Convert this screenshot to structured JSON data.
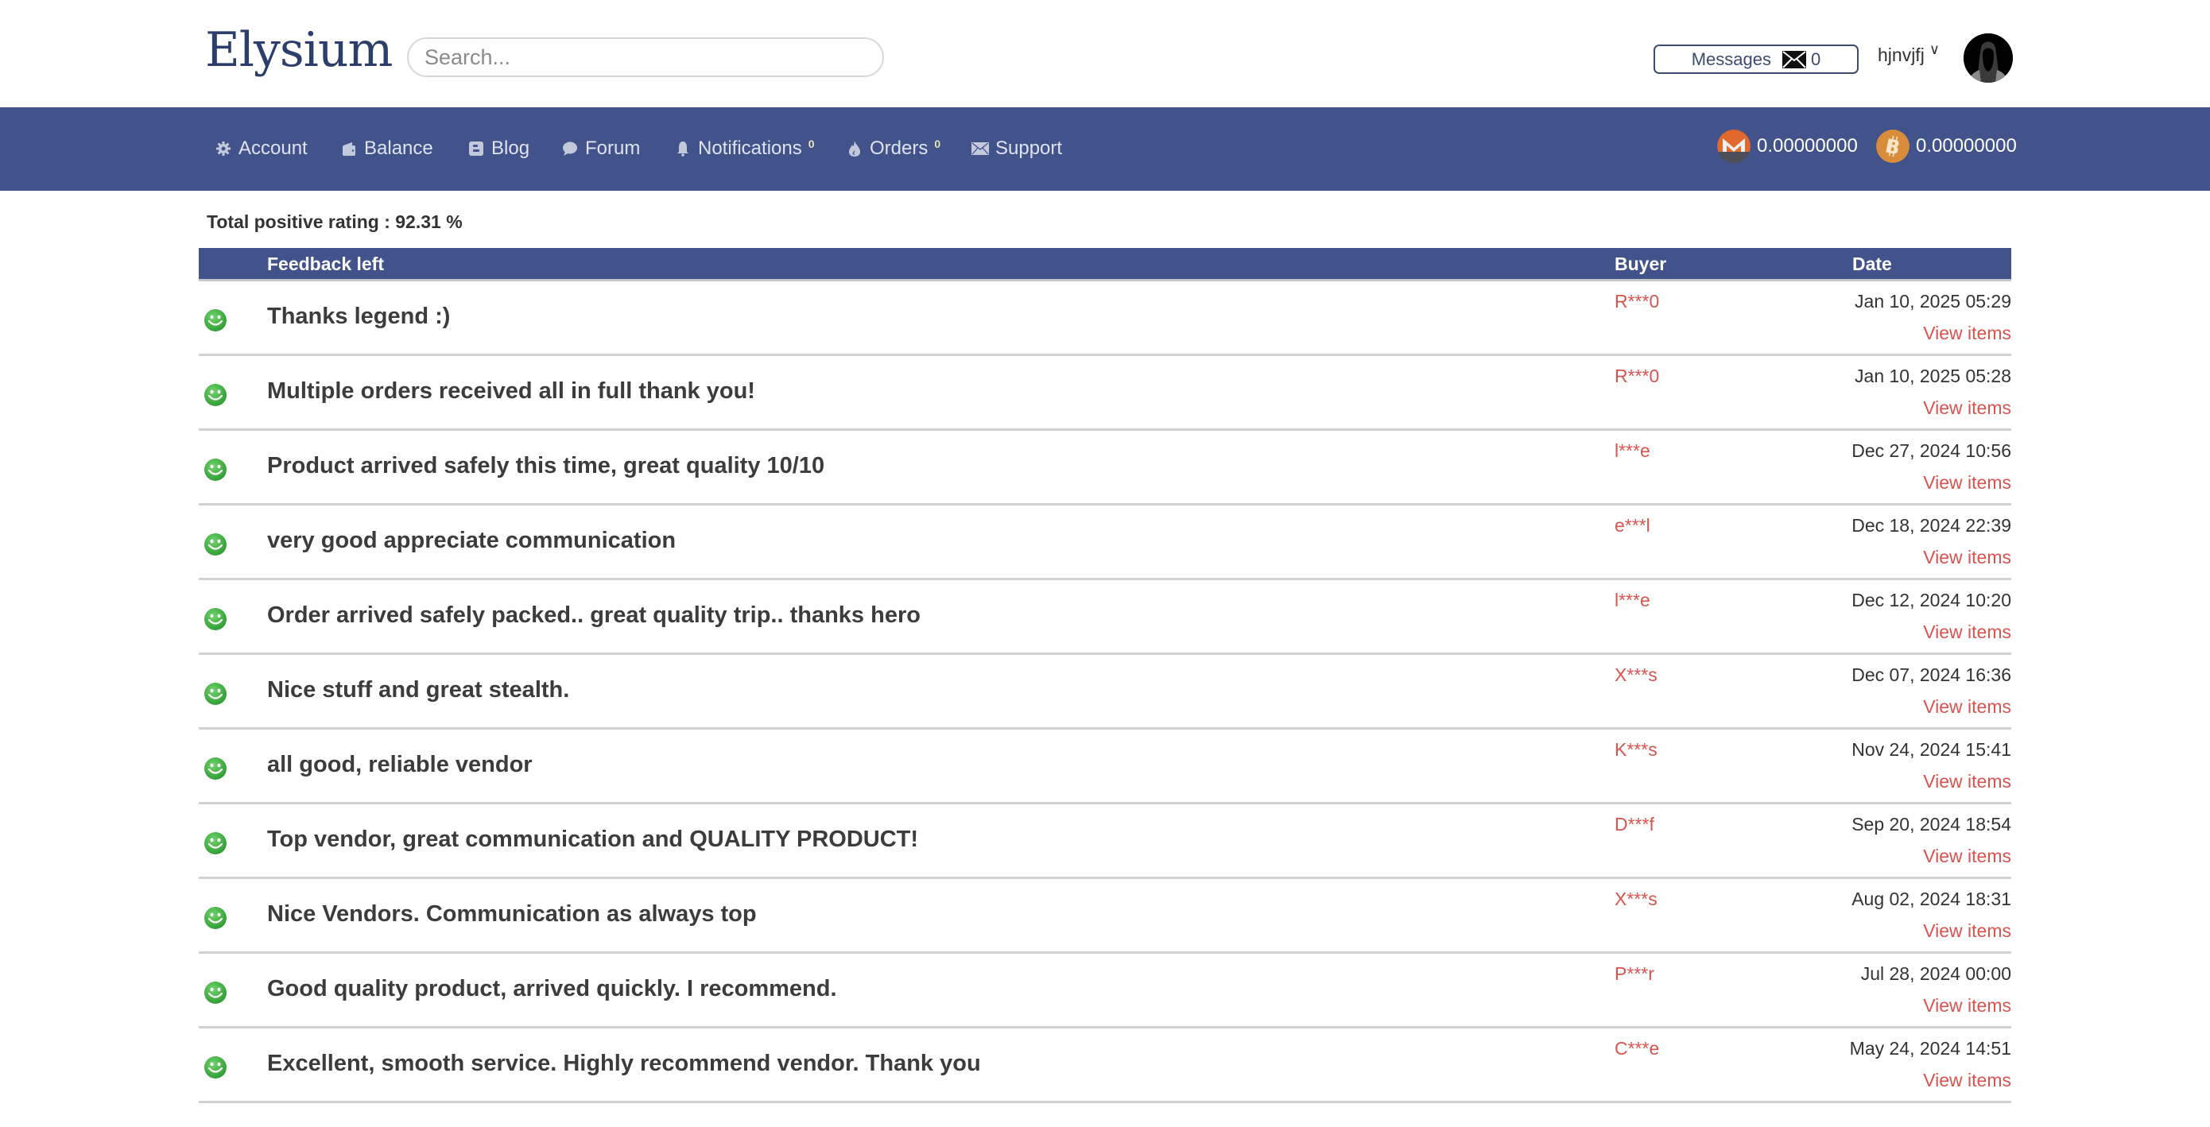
{
  "header": {
    "logo": "Elysium",
    "search_placeholder": "Search...",
    "messages_label": "Messages",
    "messages_count": "0",
    "username": "hjnvjfj",
    "dropdown_glyph": "∨"
  },
  "nav": {
    "items": [
      {
        "label": "Account",
        "icon": "gear-icon",
        "badge": ""
      },
      {
        "label": "Balance",
        "icon": "wallet-icon",
        "badge": ""
      },
      {
        "label": "Blog",
        "icon": "blog-icon",
        "badge": ""
      },
      {
        "label": "Forum",
        "icon": "chat-bubble-icon",
        "badge": ""
      },
      {
        "label": "Notifications",
        "icon": "bell-icon",
        "badge": "0"
      },
      {
        "label": "Orders",
        "icon": "fire-icon",
        "badge": "0"
      },
      {
        "label": "Support",
        "icon": "envelope-icon",
        "badge": ""
      }
    ],
    "balances": [
      {
        "currency": "monero",
        "icon": "monero-icon",
        "amount": "0.00000000",
        "color": "#e0692b"
      },
      {
        "currency": "bitcoin",
        "icon": "bitcoin-icon",
        "amount": "0.00000000",
        "color": "#d98d3a"
      }
    ]
  },
  "rating": {
    "text": "Total positive rating : 92.31 %"
  },
  "table": {
    "columns": [
      "Feedback left",
      "Buyer",
      "Date"
    ],
    "view_label": "View items",
    "rows": [
      {
        "rating": "positive",
        "feedback": "Thanks legend :)",
        "buyer": "R***0",
        "date": "Jan 10, 2025 05:29"
      },
      {
        "rating": "positive",
        "feedback": "Multiple orders received all in full thank you!",
        "buyer": "R***0",
        "date": "Jan 10, 2025 05:28"
      },
      {
        "rating": "positive",
        "feedback": "Product arrived safely this time, great quality 10/10",
        "buyer": "l***e",
        "date": "Dec 27, 2024 10:56"
      },
      {
        "rating": "positive",
        "feedback": "very good appreciate communication",
        "buyer": "e***l",
        "date": "Dec 18, 2024 22:39"
      },
      {
        "rating": "positive",
        "feedback": "Order arrived safely packed.. great quality trip.. thanks hero",
        "buyer": "l***e",
        "date": "Dec 12, 2024 10:20"
      },
      {
        "rating": "positive",
        "feedback": "Nice stuff and great stealth.",
        "buyer": "X***s",
        "date": "Dec 07, 2024 16:36"
      },
      {
        "rating": "positive",
        "feedback": "all good, reliable vendor",
        "buyer": "K***s",
        "date": "Nov 24, 2024 15:41"
      },
      {
        "rating": "positive",
        "feedback": "Top vendor, great communication and QUALITY PRODUCT!",
        "buyer": "D***f",
        "date": "Sep 20, 2024 18:54"
      },
      {
        "rating": "positive",
        "feedback": "Nice Vendors. Communication as always top",
        "buyer": "X***s",
        "date": "Aug 02, 2024 18:31"
      },
      {
        "rating": "positive",
        "feedback": "Good quality product, arrived quickly. I recommend.",
        "buyer": "P***r",
        "date": "Jul 28, 2024 00:00"
      },
      {
        "rating": "positive",
        "feedback": "Excellent, smooth service. Highly recommend vendor. Thank you",
        "buyer": "C***e",
        "date": "May 24, 2024 14:51"
      }
    ]
  },
  "colors": {
    "brand_blue": "#41538a",
    "link_red": "#d9534f",
    "positive_green": "#4caf50"
  }
}
